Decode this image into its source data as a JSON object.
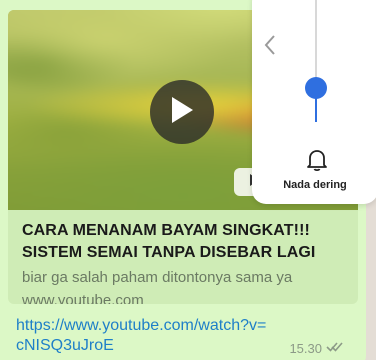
{
  "link_preview": {
    "title_line1": "CARA MENANAM BAYAM SINGKAT!!!",
    "title_line2": "SISTEM SEMAI TANPA DISEBAR LAGI",
    "description": "biar ga salah paham ditontonya sama ya",
    "domain": "www.youtube.com",
    "thumbnail_icon": "play-icon",
    "badge_icon": "youtube-icon"
  },
  "message": {
    "link_line1": "https://www.youtube.com/watch?v=",
    "link_line2": "cNISQ3uJroE",
    "time": "15.30",
    "status_icon": "double-check-icon"
  },
  "volume_panel": {
    "label": "Nada dering",
    "level": 0.28,
    "back_icon": "chevron-left-icon",
    "mode_icon": "bell-icon",
    "accent": "#2f6fe0"
  },
  "colors": {
    "bubble": "#dcf8c6",
    "link": "#1e7fc8",
    "background": "#e4ddd5"
  }
}
